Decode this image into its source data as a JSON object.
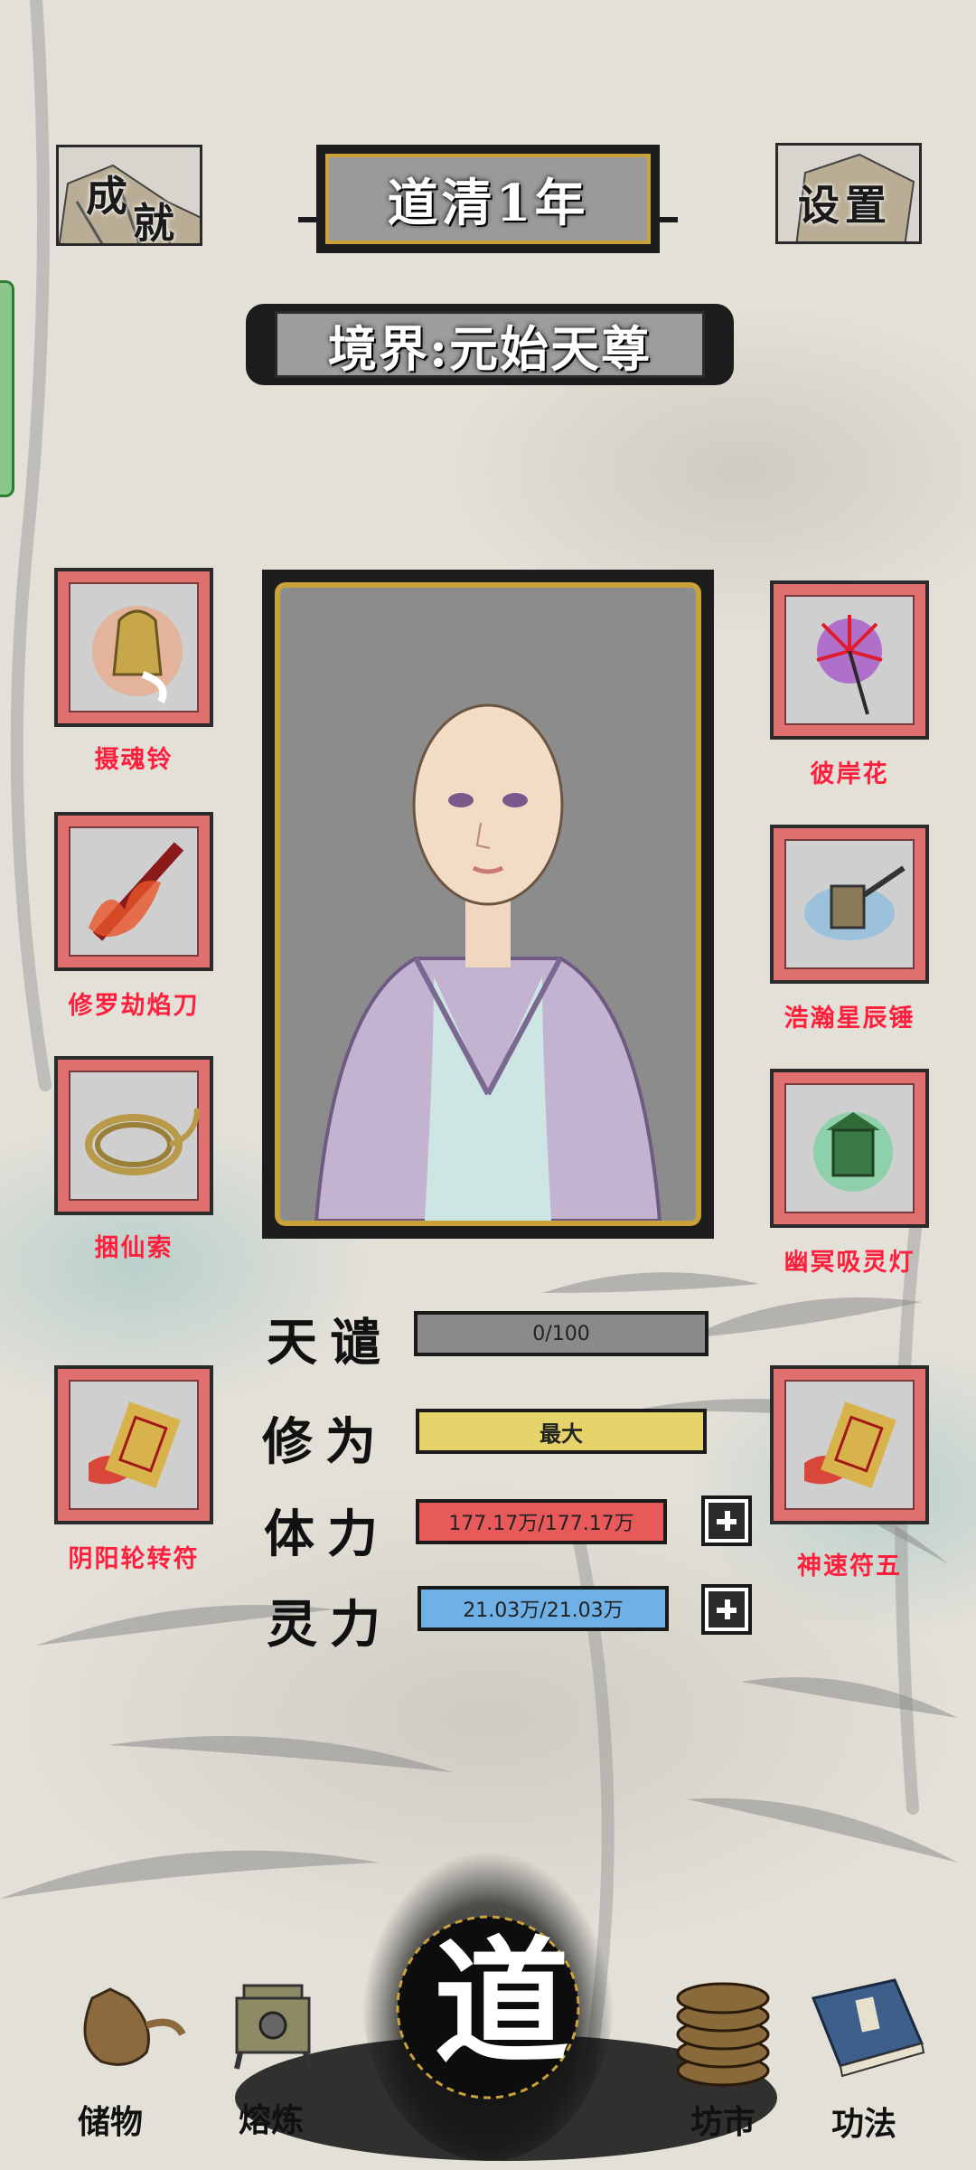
{
  "top": {
    "achievements_label_1": "成",
    "achievements_label_2": "就",
    "year_title": "道清1年",
    "settings_label": "设置",
    "realm": "境界:元始天尊"
  },
  "equipment_left": [
    {
      "name": "摄魂铃",
      "icon": "bell-icon"
    },
    {
      "name": "修罗劫焰刀",
      "icon": "flaming-sword-icon"
    },
    {
      "name": "捆仙索",
      "icon": "rope-coil-icon"
    },
    {
      "name": "阴阳轮转符",
      "icon": "talisman-scroll-icon"
    }
  ],
  "equipment_right": [
    {
      "name": "彼岸花",
      "icon": "red-spider-lily-icon"
    },
    {
      "name": "浩瀚星辰锤",
      "icon": "hammer-icon"
    },
    {
      "name": "幽冥吸灵灯",
      "icon": "green-lantern-icon"
    },
    {
      "name": "神速符五",
      "icon": "talisman-scroll-icon"
    }
  ],
  "stats": {
    "tribulation": {
      "label": "天谴",
      "value": "0/100",
      "fill": 0,
      "color": "#8a8a8a"
    },
    "cultivation": {
      "label": "修为",
      "value": "最大",
      "fill": 1,
      "color": "#e6d36a"
    },
    "stamina": {
      "label": "体力",
      "value": "177.17万/177.17万",
      "fill": 1,
      "color": "#e85a5a"
    },
    "spirit": {
      "label": "灵力",
      "value": "21.03万/21.03万",
      "fill": 1,
      "color": "#6fb0e6"
    }
  },
  "nav": {
    "storage": "储物",
    "refine": "熔炼",
    "center": "道",
    "market": "坊市",
    "skills": "功法"
  },
  "colors": {
    "item_label": "#ff1f3d",
    "slot_border": "#e07070",
    "portrait_frame": "#c9a23a"
  }
}
